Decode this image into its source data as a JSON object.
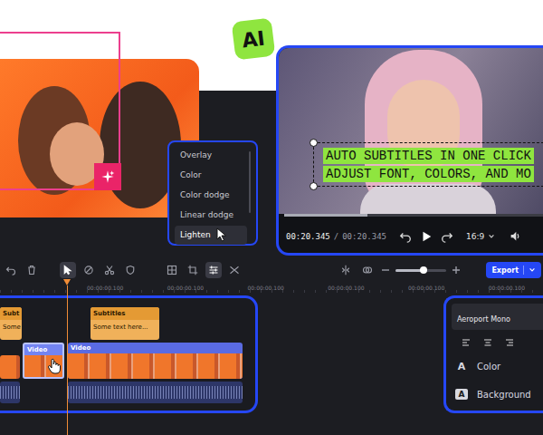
{
  "badge": {
    "label": "AI"
  },
  "blend_menu": {
    "items": [
      {
        "label": "Overlay",
        "selected": false
      },
      {
        "label": "Color",
        "selected": false
      },
      {
        "label": "Color dodge",
        "selected": false
      },
      {
        "label": "Linear dodge",
        "selected": false
      },
      {
        "label": "Lighten",
        "selected": true
      }
    ]
  },
  "preview": {
    "subtitle_lines": [
      "AUTO SUBTITLES IN ONE CLICK",
      "ADJUST FONT, COLORS, AND MO"
    ],
    "time_current": "00:20.345",
    "time_separator": "/",
    "time_total": "00:20.345",
    "progress": {
      "level": 0.31
    },
    "aspect": "16:9"
  },
  "toolbar": {
    "groups": [
      {
        "tools": [
          {
            "kind": "undo",
            "selected": false
          },
          {
            "kind": "trash",
            "selected": false
          }
        ]
      },
      {
        "tools": [
          {
            "kind": "pointer",
            "selected": true
          },
          {
            "kind": "eraser",
            "selected": false
          },
          {
            "kind": "scissors",
            "selected": false
          },
          {
            "kind": "shield",
            "selected": false
          }
        ]
      },
      {
        "tools": [
          {
            "kind": "grid",
            "selected": false
          },
          {
            "kind": "crop",
            "selected": false
          },
          {
            "kind": "adjust",
            "selected": true
          },
          {
            "kind": "transition",
            "selected": false
          }
        ]
      }
    ],
    "right_tools": [
      {
        "kind": "split",
        "selected": false
      },
      {
        "kind": "link",
        "selected": false
      }
    ],
    "zoom": {
      "level": 0.55
    },
    "export": "Export"
  },
  "ruler": [
    "00:00:00.100",
    "00:00:00.100",
    "00:00:00.100",
    "00:00:00.100",
    "00:00:00.100",
    "00:00:00.100"
  ],
  "timeline": {
    "tracks": [
      {
        "kind": "subtitle",
        "clips": [
          {
            "title": "Subt",
            "text": "Some",
            "selected": false
          },
          {
            "title": "Subtitles",
            "text": "Some text here...",
            "selected": false
          }
        ]
      },
      {
        "kind": "video",
        "clips": [
          {
            "selected": false
          },
          {
            "title": "Video",
            "selected": true
          },
          {
            "title": "Video",
            "selected": false
          }
        ]
      },
      {
        "kind": "audio",
        "clips": [
          {
            "selected": false
          },
          {
            "selected": false
          }
        ]
      }
    ]
  },
  "text_panel": {
    "font": "Aeroport Mono",
    "align": [
      {
        "kind": "left",
        "selected": false
      },
      {
        "kind": "center",
        "selected": false
      },
      {
        "kind": "right",
        "selected": false
      }
    ],
    "rows": [
      {
        "icon": "A",
        "label": "Color",
        "kind": "color"
      },
      {
        "icon": "A",
        "label": "Background",
        "kind": "background"
      }
    ]
  }
}
